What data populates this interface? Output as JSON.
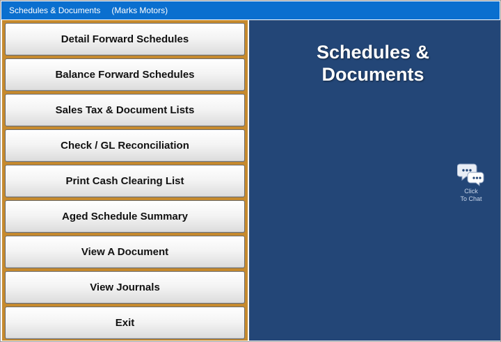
{
  "window": {
    "title": "Schedules & Documents",
    "company": "(Marks Motors)"
  },
  "menu": {
    "items": [
      {
        "label": "Detail Forward Schedules"
      },
      {
        "label": "Balance Forward Schedules"
      },
      {
        "label": "Sales Tax & Document Lists"
      },
      {
        "label": "Check / GL Reconciliation"
      },
      {
        "label": "Print Cash Clearing List"
      },
      {
        "label": "Aged Schedule Summary"
      },
      {
        "label": "View A Document"
      },
      {
        "label": "View Journals"
      },
      {
        "label": "Exit"
      }
    ]
  },
  "main": {
    "title_line1": "Schedules &",
    "title_line2": "Documents"
  },
  "chat": {
    "icon": "chat-bubbles-icon",
    "line1": "Click",
    "line2": "To Chat"
  },
  "colors": {
    "titlebar": "#0a6fcf",
    "menu_panel": "#c68a2e",
    "main_panel": "#234677"
  }
}
